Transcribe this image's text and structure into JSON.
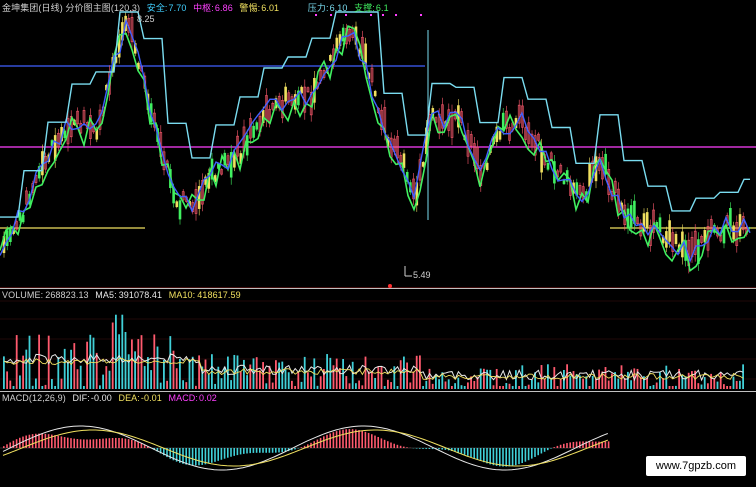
{
  "colors": {
    "background": "#000000",
    "up": "#ff5a6e",
    "down": "#40d0d8",
    "yellow": "#f0e060",
    "cyan": "#7adcf0",
    "green": "#40f060",
    "blue": "#4060ff",
    "magenta": "#ff40ff",
    "white": "#e8e8e8",
    "red": "#ff3030"
  },
  "price_header": {
    "title": "金坤集团(日线) 分价图主图(120,3)",
    "safe_label": "安全:",
    "safe_value": "7.70",
    "mid_label": "中枢:",
    "mid_value": "6.86",
    "alert_label": "警惕:",
    "alert_value": "6.01",
    "pressure_label": "压力:",
    "pressure_value": "6.10",
    "support_label": "支撑:",
    "support_value": "6.1"
  },
  "price_labels": {
    "high": "8.25",
    "low": "5.49"
  },
  "volume_header": {
    "volume_label": "VOLUME:",
    "volume_value": "268823.13",
    "ma5_label": "MA5:",
    "ma5_value": "391078.41",
    "ma10_label": "MA10:",
    "ma10_value": "418617.59"
  },
  "macd_header": {
    "title": "MACD(12,26,9)",
    "dif_label": "DIF:",
    "dif_value": "-0.00",
    "dea_label": "DEA:",
    "dea_value": "-0.01",
    "macd_label": "MACD:",
    "macd_value": "0.02"
  },
  "watermark": "www.7gpzb.com"
}
